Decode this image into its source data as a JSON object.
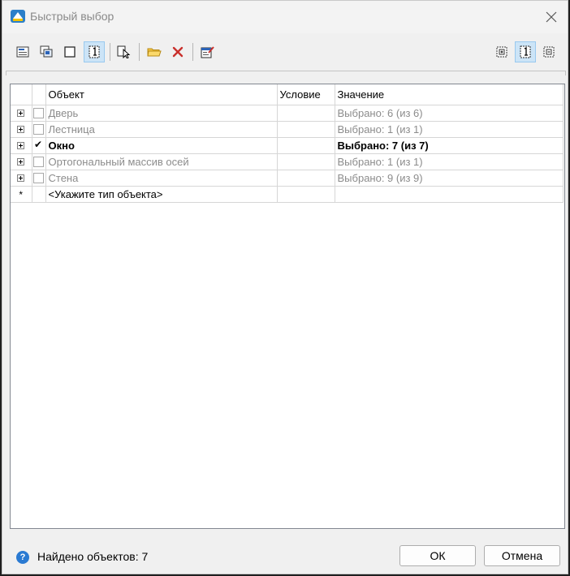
{
  "window": {
    "title": "Быстрый выбор"
  },
  "table": {
    "headers": [
      "Объект",
      "Условие",
      "Значение"
    ],
    "rows": [
      {
        "object": "Дверь",
        "condition": "",
        "value": "Выбрано: 6 (из 6)",
        "checked": false
      },
      {
        "object": "Лестница",
        "condition": "",
        "value": "Выбрано: 1 (из 1)",
        "checked": false
      },
      {
        "object": "Окно",
        "condition": "",
        "value": "Выбрано: 7 (из 7)",
        "checked": true
      },
      {
        "object": "Ортогональный массив осей",
        "condition": "",
        "value": "Выбрано: 1 (из 1)",
        "checked": false
      },
      {
        "object": "Стена",
        "condition": "",
        "value": "Выбрано: 9 (из 9)",
        "checked": false
      }
    ],
    "new_row": {
      "marker": "*",
      "placeholder": "<Укажите тип объекта>"
    }
  },
  "status": {
    "found_text": "Найдено объектов: 7"
  },
  "buttons": {
    "ok": "ОК",
    "cancel": "Отмена"
  },
  "colors": {
    "accent": "#2a7ad2",
    "active_tool": "#cce4f7"
  }
}
